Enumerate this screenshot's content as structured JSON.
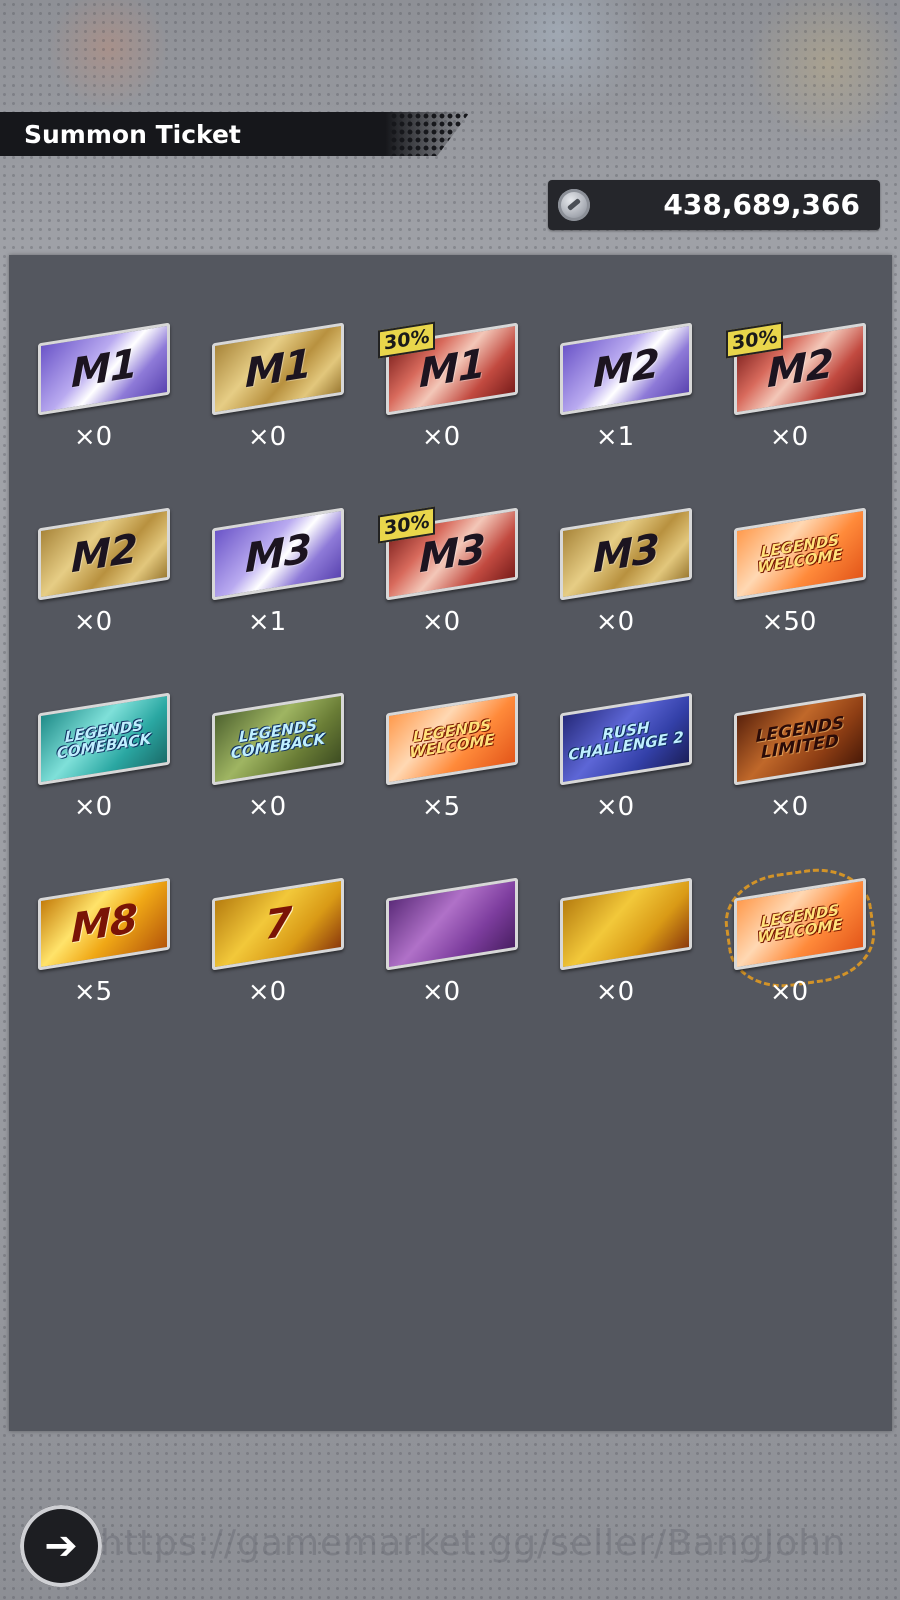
{
  "header": {
    "title": "Summon Ticket"
  },
  "currency": {
    "icon": "coin-icon",
    "value": "438,689,366"
  },
  "tickets": [
    {
      "label": "M1",
      "badge": "",
      "style": "purple",
      "count": "×0"
    },
    {
      "label": "M1",
      "badge": "",
      "style": "gold",
      "count": "×0"
    },
    {
      "label": "M1",
      "badge": "30%",
      "style": "red",
      "count": "×0"
    },
    {
      "label": "M2",
      "badge": "",
      "style": "purple",
      "count": "×1"
    },
    {
      "label": "M2",
      "badge": "30%",
      "style": "red",
      "count": "×0"
    },
    {
      "label": "M2",
      "badge": "",
      "style": "gold",
      "count": "×0"
    },
    {
      "label": "M3",
      "badge": "",
      "style": "purple",
      "count": "×1"
    },
    {
      "label": "M3",
      "badge": "30%",
      "style": "red",
      "count": "×0"
    },
    {
      "label": "M3",
      "badge": "",
      "style": "gold",
      "count": "×0"
    },
    {
      "label": "LEGENDS\nWELCOME",
      "badge": "",
      "style": "orange",
      "count": "×50"
    },
    {
      "label": "LEGENDS\nCOMEBACK",
      "badge": "",
      "style": "teal",
      "count": "×0"
    },
    {
      "label": "LEGENDS\nCOMEBACK",
      "badge": "",
      "style": "olive",
      "count": "×0"
    },
    {
      "label": "LEGENDS\nWELCOME",
      "badge": "",
      "style": "orange",
      "count": "×5"
    },
    {
      "label": "RUSH\nCHALLENGE 2",
      "badge": "",
      "style": "navy",
      "count": "×0"
    },
    {
      "label": "LEGENDS\nLIMITED",
      "badge": "",
      "style": "rust",
      "count": "×0"
    },
    {
      "label": "M8",
      "badge": "",
      "style": "fire",
      "count": "×5"
    },
    {
      "label": "7",
      "badge": "",
      "style": "amber",
      "count": "×0"
    },
    {
      "label": "",
      "badge": "",
      "style": "violet",
      "count": "×0"
    },
    {
      "label": "",
      "badge": "",
      "style": "amber",
      "count": "×0"
    },
    {
      "label": "LEGENDS\nWELCOME",
      "badge": "",
      "style": "orange-burst",
      "count": "×0"
    }
  ],
  "footer": {
    "back_icon": "back-arrow-icon",
    "watermark": "https://gamemarket.gg/seller/BangJohn"
  },
  "colors": {
    "purple": "#8e7ad8",
    "gold": "#c9a85a",
    "red": "#b84a44",
    "orange": "#f07a32",
    "teal": "#3fb3b0",
    "olive": "#7f8a3c",
    "navy": "#3b3f9c",
    "rust": "#9a4a1c",
    "fire": "#e3a11a",
    "amber": "#d9a51c",
    "violet": "#8a4aa8"
  }
}
